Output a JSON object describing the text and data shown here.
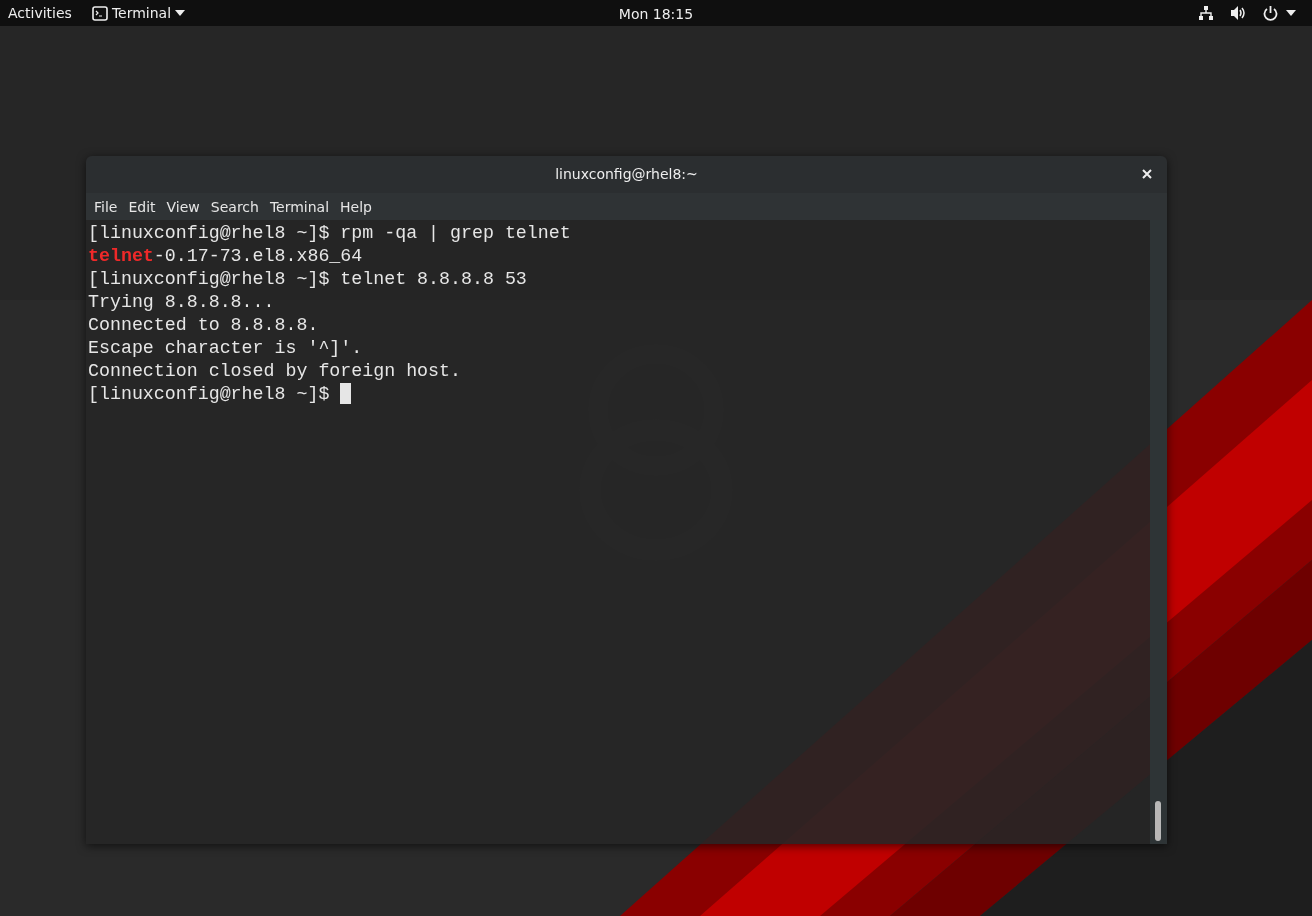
{
  "top_bar": {
    "activities": "Activities",
    "app_menu": "Terminal",
    "clock": "Mon 18:15"
  },
  "terminal": {
    "title": "linuxconfig@rhel8:~",
    "menu": [
      "File",
      "Edit",
      "View",
      "Search",
      "Terminal",
      "Help"
    ],
    "lines": [
      {
        "segments": [
          {
            "kind": "plain",
            "text": "[linuxconfig@rhel8 ~]$ rpm -qa | grep telnet"
          }
        ]
      },
      {
        "segments": [
          {
            "kind": "match",
            "text": "telnet"
          },
          {
            "kind": "plain",
            "text": "-0.17-73.el8.x86_64"
          }
        ]
      },
      {
        "segments": [
          {
            "kind": "plain",
            "text": "[linuxconfig@rhel8 ~]$ telnet 8.8.8.8 53"
          }
        ]
      },
      {
        "segments": [
          {
            "kind": "plain",
            "text": "Trying 8.8.8.8..."
          }
        ]
      },
      {
        "segments": [
          {
            "kind": "plain",
            "text": "Connected to 8.8.8.8."
          }
        ]
      },
      {
        "segments": [
          {
            "kind": "plain",
            "text": "Escape character is '^]'."
          }
        ]
      },
      {
        "segments": [
          {
            "kind": "plain",
            "text": "Connection closed by foreign host."
          }
        ]
      },
      {
        "segments": [
          {
            "kind": "plain",
            "text": "[linuxconfig@rhel8 ~]$ "
          }
        ],
        "cursor": true
      }
    ]
  }
}
